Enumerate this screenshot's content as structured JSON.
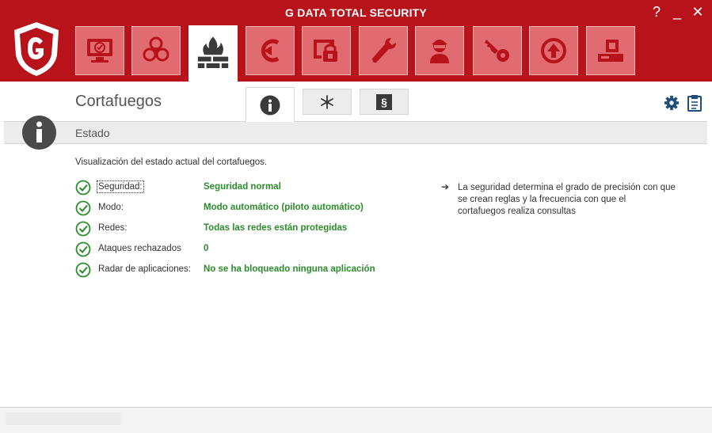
{
  "window": {
    "title": "G DATA TOTAL SECURITY",
    "help": "?",
    "minimize": "_",
    "close": "✕"
  },
  "nav": [
    {
      "name": "status-monitor-icon"
    },
    {
      "name": "virus-protection-icon"
    },
    {
      "name": "firewall-icon",
      "active": true
    },
    {
      "name": "backup-icon"
    },
    {
      "name": "encryption-safe-icon"
    },
    {
      "name": "tuner-icon"
    },
    {
      "name": "parental-control-icon"
    },
    {
      "name": "password-manager-icon"
    },
    {
      "name": "autostart-manager-icon"
    },
    {
      "name": "device-control-icon"
    }
  ],
  "page": {
    "title": "Cortafuegos",
    "tabs": [
      {
        "name": "tab-info",
        "icon": "info-icon",
        "active": true
      },
      {
        "name": "tab-snowflake",
        "icon": "snowflake-icon"
      },
      {
        "name": "tab-rules",
        "icon": "section-icon",
        "glyph": "§"
      }
    ],
    "tools": [
      "gear-icon",
      "clipboard-icon"
    ]
  },
  "section": {
    "label": "Estado"
  },
  "content": {
    "description": "Visualización del estado actual del cortafuegos.",
    "rows": [
      {
        "label": "Seguridad:",
        "value": "Seguridad normal"
      },
      {
        "label": "Modo:",
        "value": "Modo automático (piloto automático)"
      },
      {
        "label": "Redes:",
        "value": "Todas las redes están protegidas"
      },
      {
        "label": "Ataques rechazados",
        "value": "0"
      },
      {
        "label": "Radar de aplicaciones:",
        "value": "No se ha bloqueado ninguna aplicación"
      }
    ],
    "hint_arrow": "➔",
    "hint": "La seguridad determina el grado de precisión con que se crean reglas y la frecuencia con que el cortafuegos realiza consultas"
  },
  "colors": {
    "brand_red": "#b8121b",
    "tile_red": "#e06b70",
    "ok_green": "#2a8c2a"
  }
}
